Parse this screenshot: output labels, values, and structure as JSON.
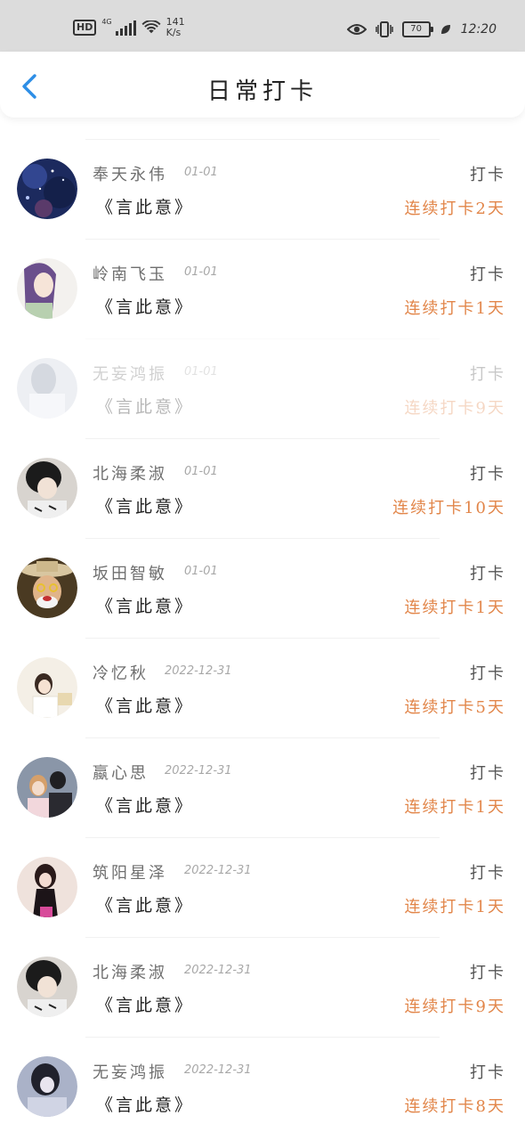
{
  "status_bar": {
    "hd": "HD",
    "network": "4G",
    "speed_value": "141",
    "speed_unit": "K/s",
    "battery": "70",
    "time": "12:20"
  },
  "header": {
    "title": "日常打卡",
    "back_icon": "chevron-left-icon"
  },
  "list": {
    "items": [
      {
        "name": "奉天永伟",
        "date": "01-01",
        "book": "《言此意》",
        "action": "打卡",
        "streak": "连续打卡2天",
        "faded": false
      },
      {
        "name": "岭南飞玉",
        "date": "01-01",
        "book": "《言此意》",
        "action": "打卡",
        "streak": "连续打卡1天",
        "faded": false
      },
      {
        "name": "无妄鸿振",
        "date": "01-01",
        "book": "《言此意》",
        "action": "打卡",
        "streak": "连续打卡9天",
        "faded": true
      },
      {
        "name": "北海柔淑",
        "date": "01-01",
        "book": "《言此意》",
        "action": "打卡",
        "streak": "连续打卡10天",
        "faded": false
      },
      {
        "name": "坂田智敏",
        "date": "01-01",
        "book": "《言此意》",
        "action": "打卡",
        "streak": "连续打卡1天",
        "faded": false
      },
      {
        "name": "冷忆秋",
        "date": "2022-12-31",
        "book": "《言此意》",
        "action": "打卡",
        "streak": "连续打卡5天",
        "faded": false
      },
      {
        "name": "蠃心思",
        "date": "2022-12-31",
        "book": "《言此意》",
        "action": "打卡",
        "streak": "连续打卡1天",
        "faded": false
      },
      {
        "name": "筑阳星泽",
        "date": "2022-12-31",
        "book": "《言此意》",
        "action": "打卡",
        "streak": "连续打卡1天",
        "faded": false
      },
      {
        "name": "北海柔淑",
        "date": "2022-12-31",
        "book": "《言此意》",
        "action": "打卡",
        "streak": "连续打卡9天",
        "faded": false
      },
      {
        "name": "无妄鸿振",
        "date": "2022-12-31",
        "book": "《言此意》",
        "action": "打卡",
        "streak": "连续打卡8天",
        "faded": false
      }
    ]
  },
  "colors": {
    "accent": "#2d8ee6",
    "streak": "#e2864a",
    "status_bar_bg": "#dcdcdc"
  }
}
